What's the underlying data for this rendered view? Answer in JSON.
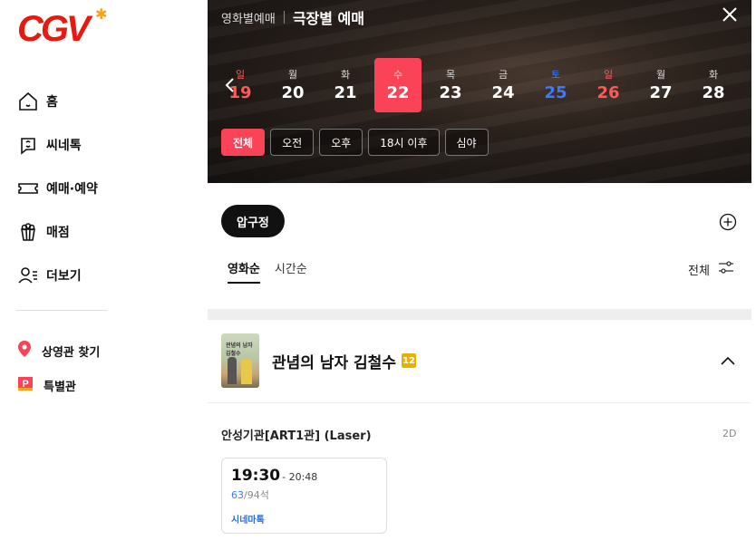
{
  "brand": {
    "logo_text": "CGV",
    "accent": "#fb4357",
    "logo_color": "#e71a0f"
  },
  "sidebar": {
    "items": [
      {
        "label": "홈",
        "icon": "home-icon"
      },
      {
        "label": "씨네톡",
        "icon": "chat-icon"
      },
      {
        "label": "예매·예약",
        "icon": "ticket-icon"
      },
      {
        "label": "매점",
        "icon": "popcorn-icon"
      },
      {
        "label": "더보기",
        "icon": "more-menu-icon"
      }
    ],
    "sub_items": [
      {
        "label": "상영관 찾기",
        "icon": "location-pin-icon"
      },
      {
        "label": "특별관",
        "icon": "special-hall-icon"
      }
    ]
  },
  "header": {
    "breadcrumb_parent": "영화별예매",
    "title": "극장별 예매"
  },
  "dates": [
    {
      "weekday": "일",
      "day": "19",
      "kind": "sun"
    },
    {
      "weekday": "월",
      "day": "20",
      "kind": ""
    },
    {
      "weekday": "화",
      "day": "21",
      "kind": ""
    },
    {
      "weekday": "수",
      "day": "22",
      "kind": "sel"
    },
    {
      "weekday": "목",
      "day": "23",
      "kind": ""
    },
    {
      "weekday": "금",
      "day": "24",
      "kind": ""
    },
    {
      "weekday": "토",
      "day": "25",
      "kind": "sat"
    },
    {
      "weekday": "일",
      "day": "26",
      "kind": "sun"
    },
    {
      "weekday": "월",
      "day": "27",
      "kind": ""
    },
    {
      "weekday": "화",
      "day": "28",
      "kind": ""
    }
  ],
  "time_filters": [
    "전체",
    "오전",
    "오후",
    "18시 이후",
    "심야"
  ],
  "theater": {
    "name": "압구정"
  },
  "sort": {
    "by_movie": "영화순",
    "by_time": "시간순",
    "filter_all": "전체"
  },
  "movie": {
    "title": "관념의 남자 김철수",
    "rating": "12",
    "poster_text": "관념의 남자 김철수"
  },
  "showing": {
    "hall": "안성기관[ART1관] (Laser)",
    "format": "2D",
    "start": "19:30",
    "end": "- 20:48",
    "seats_available": "63",
    "seats_total": "/94석",
    "tag": "시네마톡"
  }
}
